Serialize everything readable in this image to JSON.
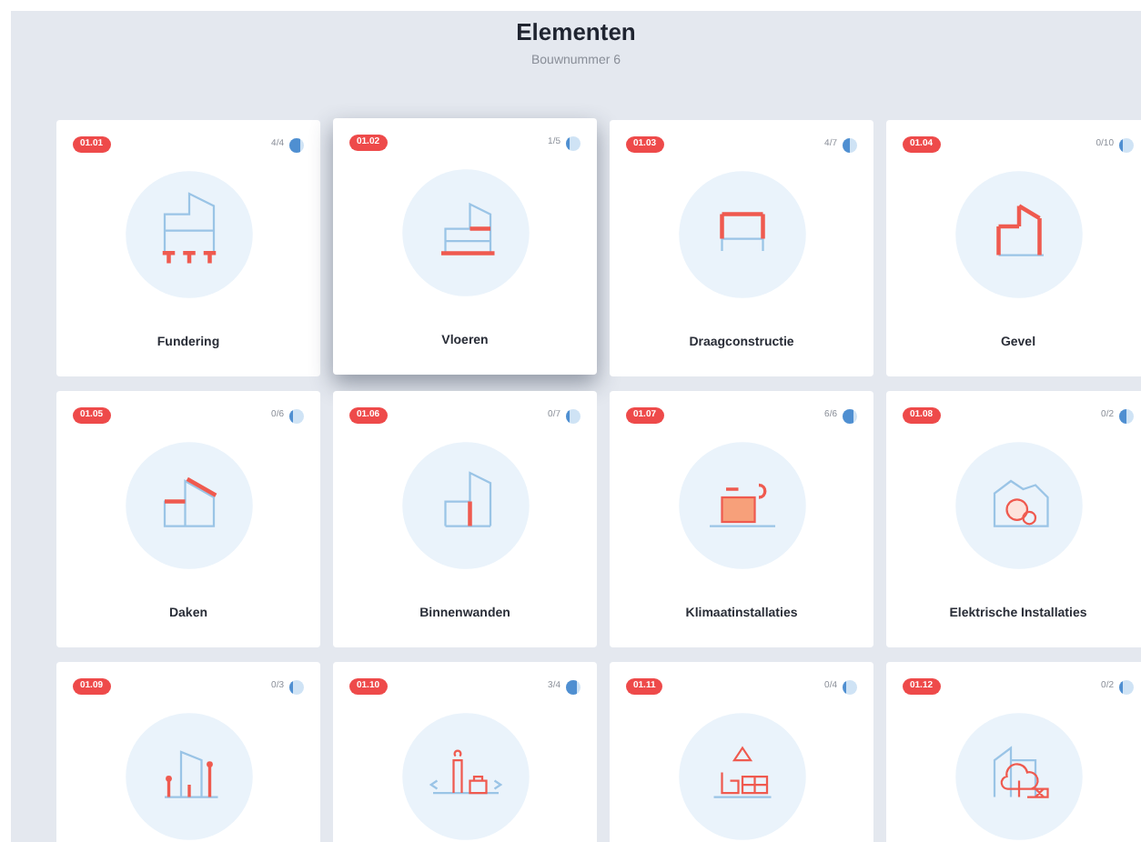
{
  "header": {
    "title": "Elementen",
    "subtitle": "Bouwnummer 6"
  },
  "cards": [
    {
      "badge": "01.01",
      "count": "4/4",
      "level": 0.7,
      "title": "Fundering",
      "selected": false
    },
    {
      "badge": "01.02",
      "count": "1/5",
      "level": 0.2,
      "title": "Vloeren",
      "selected": true
    },
    {
      "badge": "01.03",
      "count": "4/7",
      "level": 0.5,
      "title": "Draagconstructie",
      "selected": false
    },
    {
      "badge": "01.04",
      "count": "0/10",
      "level": 0.3,
      "title": "Gevel",
      "selected": false
    },
    {
      "badge": "01.05",
      "count": "0/6",
      "level": 0.2,
      "title": "Daken",
      "selected": false
    },
    {
      "badge": "01.06",
      "count": "0/7",
      "level": 0.2,
      "title": "Binnenwanden",
      "selected": false
    },
    {
      "badge": "01.07",
      "count": "6/6",
      "level": 0.8,
      "title": "Klimaatinstallaties",
      "selected": false
    },
    {
      "badge": "01.08",
      "count": "0/2",
      "level": 0.5,
      "title": "Elektrische Installaties",
      "selected": false
    },
    {
      "badge": "01.09",
      "count": "0/3",
      "level": 0.2,
      "selected": false
    },
    {
      "badge": "01.10",
      "count": "3/4",
      "level": 0.75,
      "selected": false
    },
    {
      "badge": "01.11",
      "count": "0/4",
      "level": 0.2,
      "selected": false
    },
    {
      "badge": "01.12",
      "count": "0/2",
      "level": 0.2,
      "selected": false
    }
  ]
}
